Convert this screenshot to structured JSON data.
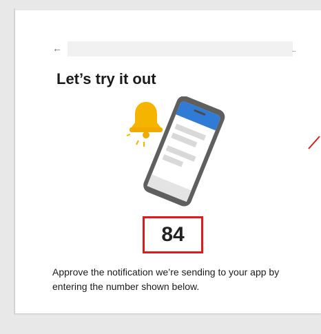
{
  "header": {
    "back_icon": "arrow-left-icon",
    "ellipsis": ".."
  },
  "main": {
    "title": "Let’s try it out",
    "number": "84",
    "description": "Approve the notification we’re sending to your app by entering the number shown below."
  },
  "colors": {
    "highlight": "#e01919",
    "phone_header": "#2f7bd6",
    "bell": "#f5b400",
    "phone_frame": "#5f5f5f"
  },
  "icons": {
    "bell": "bell-icon",
    "phone": "phone-icon"
  }
}
